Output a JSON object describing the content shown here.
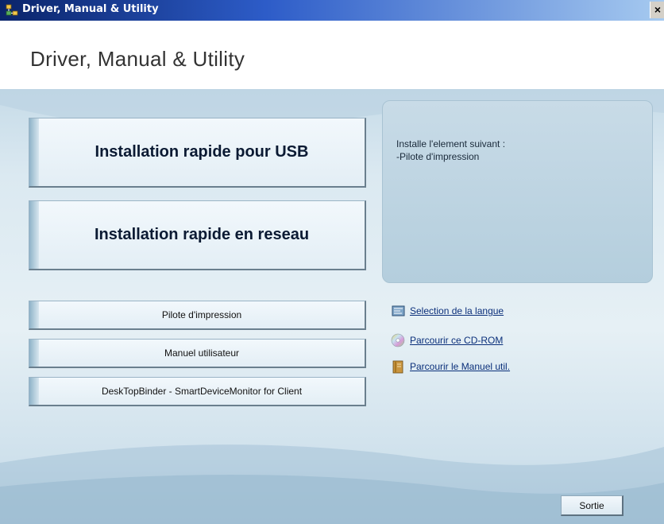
{
  "window": {
    "title": "Driver, Manual & Utility",
    "close_glyph": "×"
  },
  "header": {
    "title": "Driver, Manual & Utility"
  },
  "main_buttons": [
    {
      "label": "Installation rapide pour USB"
    },
    {
      "label": "Installation rapide en reseau"
    }
  ],
  "secondary_buttons": [
    {
      "label": "Pilote d'impression"
    },
    {
      "label": "Manuel utilisateur"
    },
    {
      "label": "DeskTopBinder - SmartDeviceMonitor for Client"
    }
  ],
  "info_panel": {
    "line1": "Installe l'element suivant :",
    "line2": "-Pilote  d'impression"
  },
  "links": [
    {
      "label": "Selection de la langue",
      "icon": "language-flag-icon"
    },
    {
      "label": "Parcourir ce CD-ROM",
      "icon": "cd-rom-icon"
    },
    {
      "label": "Parcourir le Manuel util.",
      "icon": "manual-book-icon"
    }
  ],
  "exit_button": {
    "label": "Sortie"
  },
  "colors": {
    "titlebar_start": "#0a246a",
    "titlebar_end": "#a6caf0",
    "button_text": "#0b1a33",
    "link_text": "#0a2f7a"
  }
}
